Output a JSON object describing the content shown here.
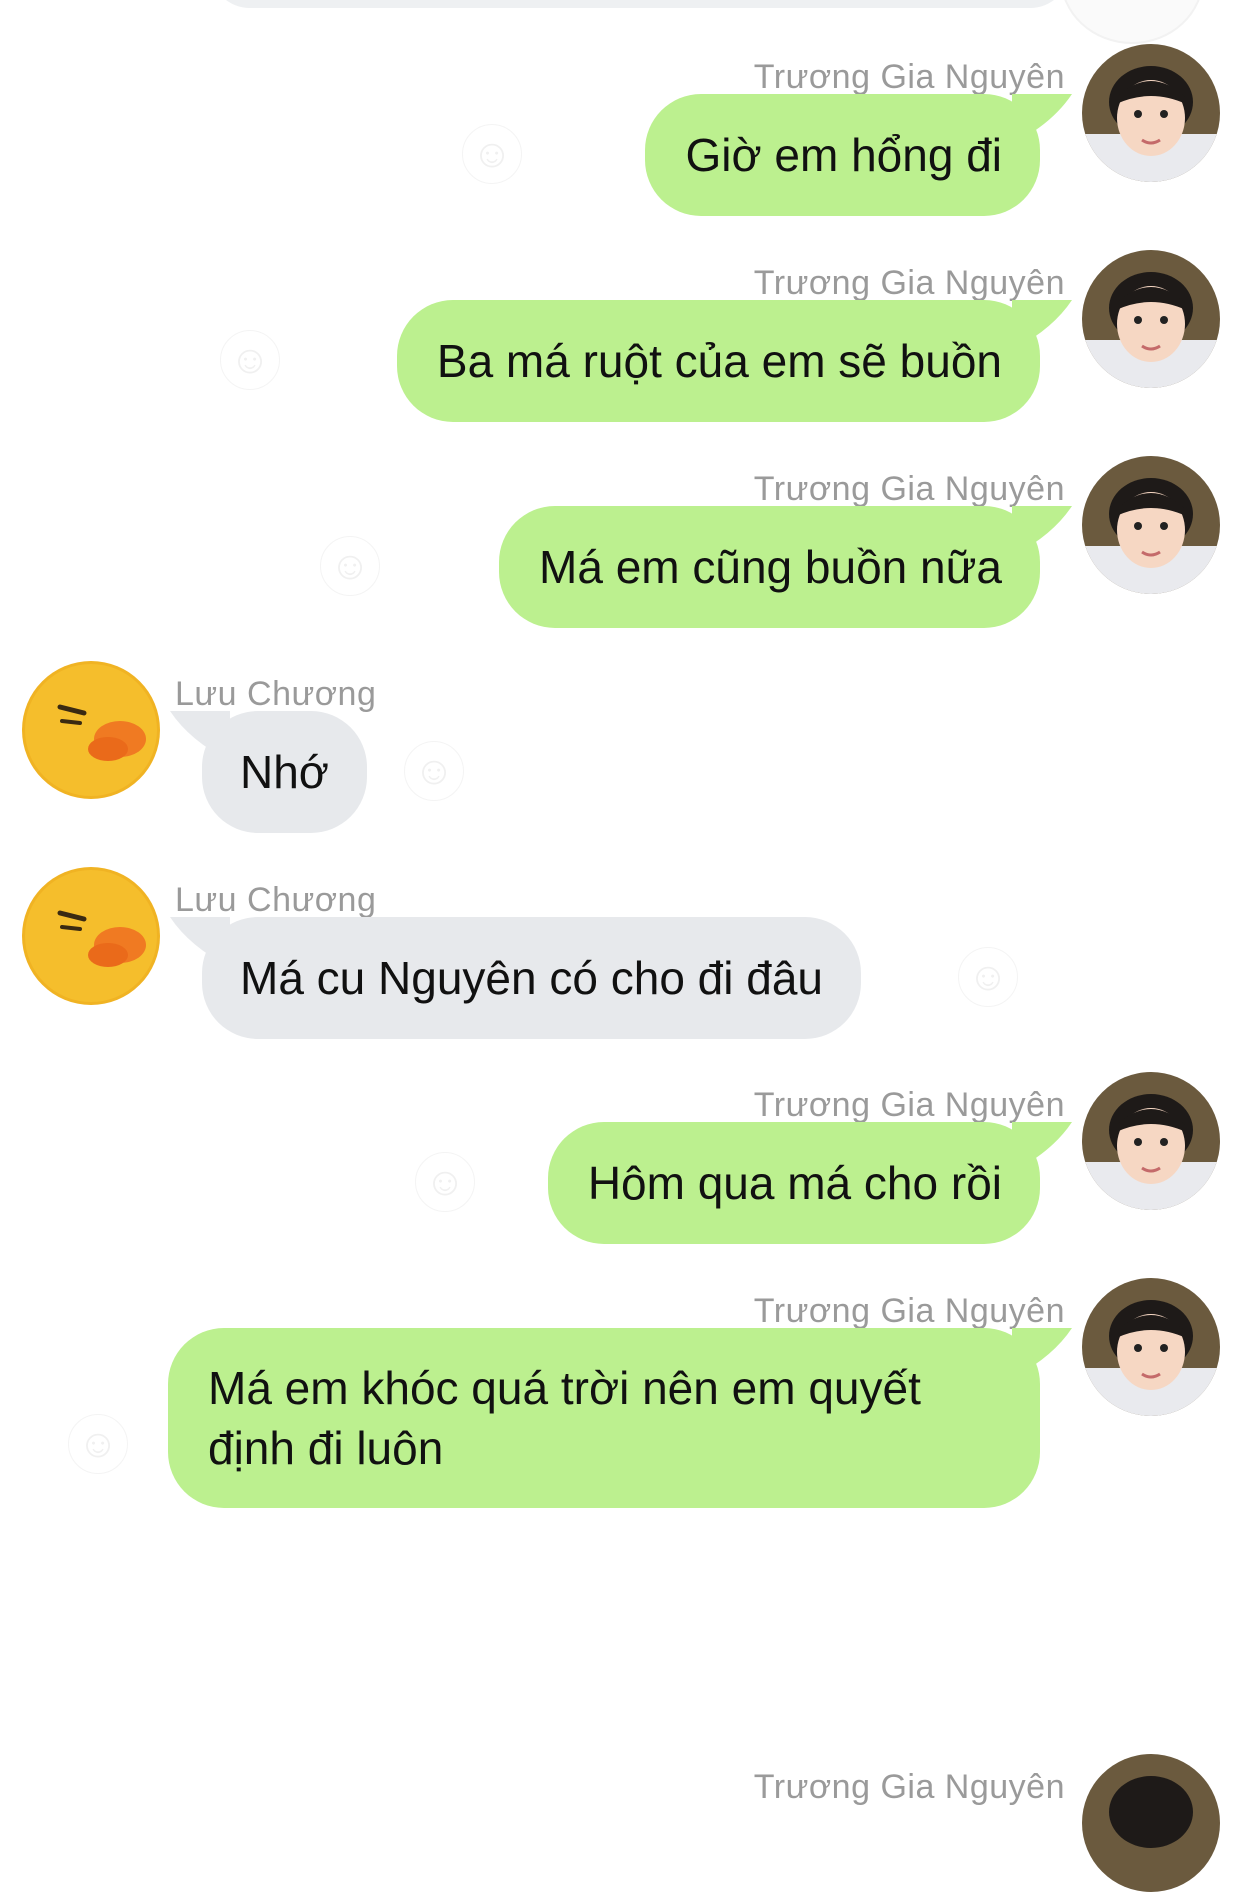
{
  "conversation": {
    "sender_names": {
      "me": "Trương Gia Nguyên",
      "other": "Lưu Chương"
    },
    "messages": [
      {
        "sender": "Trương Gia Nguyên",
        "side": "out",
        "text": "Giờ em hổng đi"
      },
      {
        "sender": "Trương Gia Nguyên",
        "side": "out",
        "text": "Ba má ruột của em sẽ buồn"
      },
      {
        "sender": "Trương Gia Nguyên",
        "side": "out",
        "text": "Má em cũng buồn nữa"
      },
      {
        "sender": "Lưu Chương",
        "side": "in",
        "text": "Nhớ"
      },
      {
        "sender": "Lưu Chương",
        "side": "in",
        "text": "Má cu Nguyên có cho đi đâu"
      },
      {
        "sender": "Trương Gia Nguyên",
        "side": "out",
        "text": "Hôm qua má cho rồi"
      },
      {
        "sender": "Trương Gia Nguyên",
        "side": "out",
        "text": "Má em khóc quá trời nên em quyết định đi luôn"
      },
      {
        "sender": "Trương Gia Nguyên",
        "side": "out",
        "text": ""
      }
    ]
  },
  "icons": {
    "reaction": "smiley-add-icon",
    "avatar_me": "boy-photo-avatar",
    "avatar_other": "duck-avatar"
  },
  "colors": {
    "outgoing_bubble": "#bcf08f",
    "incoming_bubble": "#e7e9ec",
    "name_text": "#9a9a9a",
    "background": "#ffffff"
  }
}
